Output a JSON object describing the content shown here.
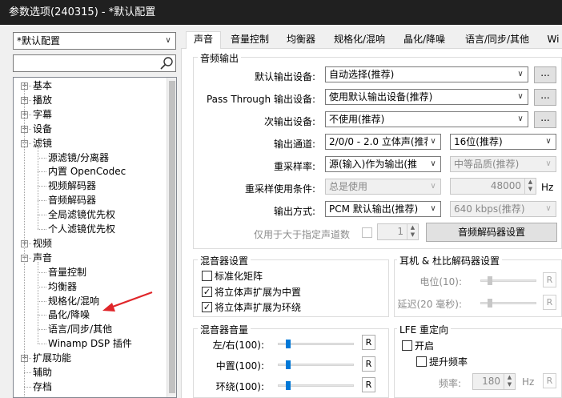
{
  "window": {
    "title": "参数选项(240315) - *默认配置"
  },
  "profile": {
    "selected": "*默认配置"
  },
  "search": {
    "value": ""
  },
  "tree": {
    "items": [
      {
        "label": "基本",
        "level": 0,
        "expander": "+"
      },
      {
        "label": "播放",
        "level": 0,
        "expander": "+"
      },
      {
        "label": "字幕",
        "level": 0,
        "expander": "+"
      },
      {
        "label": "设备",
        "level": 0,
        "expander": "+"
      },
      {
        "label": "滤镜",
        "level": 0,
        "expander": "-"
      },
      {
        "label": "源滤镜/分离器",
        "level": 1
      },
      {
        "label": "内置 OpenCodec",
        "level": 1
      },
      {
        "label": "视频解码器",
        "level": 1
      },
      {
        "label": "音频解码器",
        "level": 1
      },
      {
        "label": "全局滤镜优先权",
        "level": 1
      },
      {
        "label": "个人滤镜优先权",
        "level": 1
      },
      {
        "label": "视频",
        "level": 0,
        "expander": "+"
      },
      {
        "label": "声音",
        "level": 0,
        "expander": "-"
      },
      {
        "label": "音量控制",
        "level": 1
      },
      {
        "label": "均衡器",
        "level": 1
      },
      {
        "label": "规格化/混响",
        "level": 1
      },
      {
        "label": "晶化/降噪",
        "level": 1
      },
      {
        "label": "语言/同步/其他",
        "level": 1
      },
      {
        "label": "Winamp DSP 插件",
        "level": 1
      },
      {
        "label": "扩展功能",
        "level": 0,
        "expander": "+"
      },
      {
        "label": "辅助",
        "level": 0
      },
      {
        "label": "存档",
        "level": 0
      }
    ]
  },
  "tabs": [
    "声音",
    "音量控制",
    "均衡器",
    "规格化/混响",
    "晶化/降噪",
    "语言/同步/其他",
    "Wi"
  ],
  "audio_output": {
    "title": "音频输出",
    "default_device_label": "默认输出设备:",
    "default_device_value": "自动选择(推荐)",
    "passthrough_label": "Pass Through 输出设备:",
    "passthrough_value": "使用默认输出设备(推荐)",
    "secondary_label": "次输出设备:",
    "secondary_value": "不使用(推荐)",
    "more_button": "...",
    "channel_label": "输出通道:",
    "channel_value": "2/0/0 - 2.0 立体声(推荐",
    "bitdepth_value": "16位(推荐)",
    "resample_label": "重采样率:",
    "resample_value": "源(输入)作为输出(推",
    "quality_value": "中等品质(推荐)",
    "resample_cond_label": "重采样使用条件:",
    "resample_cond_value": "总是使用",
    "hz_value": "48000",
    "hz_unit": "Hz",
    "output_mode_label": "输出方式:",
    "output_mode_value": "PCM 默认输出(推荐)",
    "bitrate_value": "640 kbps(推荐)",
    "channels_only_label": "仅用于大于指定声道数",
    "channels_only_value": "1",
    "audio_decoder_button": "音频解码器设置"
  },
  "mixer_settings": {
    "title": "混音器设置",
    "normalize_label": "标准化矩阵",
    "normalize_checked": false,
    "expand_center_label": "将立体声扩展为中置",
    "expand_center_checked": true,
    "expand_surround_label": "将立体声扩展为环绕",
    "expand_surround_checked": true
  },
  "headphone": {
    "title": "耳机 & 杜比解码器设置",
    "level_label": "电位(10):",
    "delay_label": "延迟(20 毫秒):",
    "reset": "R",
    "level_fraction": 0.13,
    "delay_fraction": 0.13
  },
  "mixer_volume": {
    "title": "混音器音量",
    "lr_label": "左/右(100):",
    "center_label": "中置(100):",
    "surround_label": "环绕(100):",
    "reset": "R",
    "lr_fraction": 0.1,
    "center_fraction": 0.1,
    "surround_fraction": 0.1
  },
  "lfe": {
    "title": "LFE 重定向",
    "enable_label": "开启",
    "enable_checked": false,
    "boost_label": "提升频率",
    "boost_checked": false,
    "freq_label": "频率:",
    "freq_value": "180",
    "freq_unit": "Hz",
    "reset": "R"
  }
}
